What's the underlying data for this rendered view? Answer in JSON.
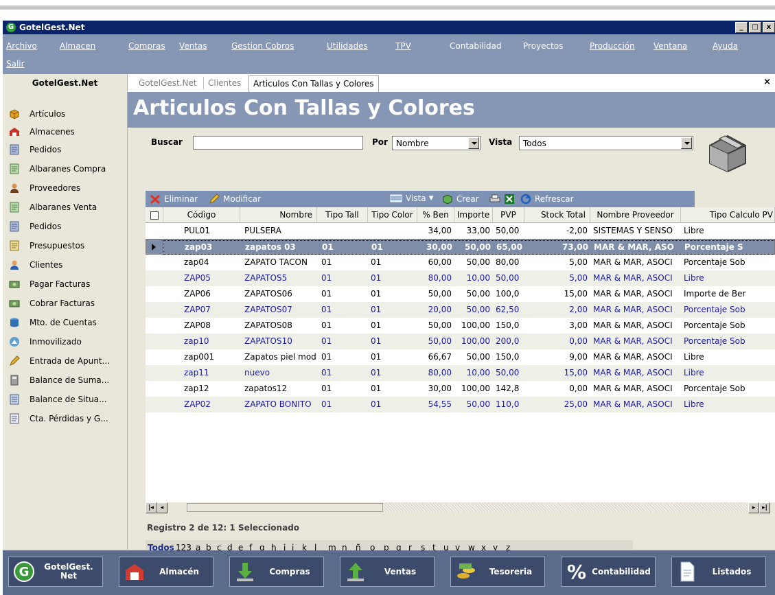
{
  "window": {
    "title": "GotelGest.Net",
    "btn_min": "_",
    "btn_max": "□",
    "btn_close": "x"
  },
  "menu": [
    "Archivo",
    "Almacen",
    "Compras",
    "Ventas",
    "Gestion Cobros",
    "Utilidades",
    "TPV",
    "Contabilidad",
    "Proyectos",
    "Producción",
    "Ventana",
    "Ayuda",
    "Salir"
  ],
  "sidebar": {
    "title": "GotelGest.Net",
    "items": [
      {
        "label": "Artículos",
        "icon": "box-icon"
      },
      {
        "label": "Almacenes",
        "icon": "warehouse-icon"
      },
      {
        "label": "Pedidos",
        "icon": "document-icon"
      },
      {
        "label": "Albaranes Compra",
        "icon": "document-icon"
      },
      {
        "label": "Proveedores",
        "icon": "person-icon"
      },
      {
        "label": "Albaranes Venta",
        "icon": "document-icon"
      },
      {
        "label": "Pedidos",
        "icon": "document-icon"
      },
      {
        "label": "Presupuestos",
        "icon": "document-icon"
      },
      {
        "label": "Clientes",
        "icon": "person-icon"
      },
      {
        "label": "Pagar Facturas",
        "icon": "money-icon"
      },
      {
        "label": "Cobrar Facturas",
        "icon": "money-icon"
      },
      {
        "label": "Mto. de Cuentas",
        "icon": "database-icon"
      },
      {
        "label": "Inmovilizado",
        "icon": "building-icon"
      },
      {
        "label": "Entrada de Apunt...",
        "icon": "pencil-icon"
      },
      {
        "label": "Balance de Suma...",
        "icon": "calculator-icon"
      },
      {
        "label": "Balance de Situa...",
        "icon": "ledger-icon"
      },
      {
        "label": "Cta. Pérdidas y G...",
        "icon": "report-icon"
      }
    ]
  },
  "tabs": {
    "crumb1": "GotelGest.Net",
    "crumb2": "Clientes",
    "active": "Articulos Con Tallas y Colores",
    "close": "×"
  },
  "page_title": "Articulos Con Tallas y Colores",
  "search": {
    "buscar_label": "Buscar",
    "buscar_value": "",
    "por_label": "Por",
    "por_value": "Nombre",
    "vista_label": "Vista",
    "vista_value": "Todos"
  },
  "toolbar": {
    "eliminar": "Eliminar",
    "modificar": "Modificar",
    "vista": "Vista",
    "crear": "Crear",
    "refrescar": "Refrescar"
  },
  "columns": [
    "Código",
    "Nombre",
    "Tipo Tall",
    "Tipo Color",
    "% Ben",
    "Importe",
    "PVP",
    "Stock Total",
    "Nombre Proveedor",
    "Tipo Calculo PV"
  ],
  "rows": [
    [
      "PUL01",
      "PULSERA",
      "",
      "",
      "34,00",
      "33,00",
      "50,00",
      "-2,00",
      "SISTEMAS Y SENSO",
      "Libre"
    ],
    [
      "zap03",
      "zapatos 03",
      "01",
      "01",
      "30,00",
      "50,00",
      "65,00",
      "73,00",
      "MAR & MAR, ASO",
      "Porcentaje S"
    ],
    [
      "zap04",
      "ZAPATO TACON",
      "01",
      "01",
      "60,00",
      "50,00",
      "80,00",
      "5,00",
      "MAR & MAR, ASOCI",
      "Porcentaje Sob"
    ],
    [
      "ZAP05",
      "ZAPATOS5",
      "01",
      "01",
      "80,00",
      "10,00",
      "50,00",
      "5,00",
      "MAR & MAR, ASOCI",
      "Libre"
    ],
    [
      "ZAP06",
      "ZAPATOS06",
      "01",
      "01",
      "50,00",
      "50,00",
      "100,0",
      "15,00",
      "MAR & MAR, ASOCI",
      "Importe de Ber"
    ],
    [
      "ZAP07",
      "ZAPATOS07",
      "01",
      "01",
      "20,00",
      "50,00",
      "62,50",
      "2,00",
      "MAR & MAR, ASOCI",
      "Porcentaje Sob"
    ],
    [
      "ZAP08",
      "ZAPATOS08",
      "01",
      "01",
      "50,00",
      "100,00",
      "150,0",
      "3,00",
      "MAR & MAR, ASOCI",
      "Porcentaje Sob"
    ],
    [
      "zap10",
      "ZAPATOS10",
      "01",
      "01",
      "50,00",
      "100,00",
      "200,0",
      "0,00",
      "MAR & MAR, ASOCI",
      "Porcentaje Sob"
    ],
    [
      "zap001",
      "Zapatos piel mod",
      "01",
      "01",
      "66,67",
      "50,00",
      "150,0",
      "9,00",
      "MAR & MAR, ASOCI",
      "Libre"
    ],
    [
      "zap11",
      "nuevo",
      "01",
      "01",
      "80,00",
      "10,00",
      "50,00",
      "15,00",
      "MAR & MAR, ASOCI",
      "Libre"
    ],
    [
      "zap12",
      "zapatos12",
      "01",
      "01",
      "30,00",
      "100,00",
      "142,8",
      "0,00",
      "MAR & MAR, ASOCI",
      "Porcentaje Sob"
    ],
    [
      "ZAP02",
      "ZAPATO BONITO",
      "01",
      "01",
      "54,55",
      "50,00",
      "110,0",
      "25,00",
      "MAR & MAR, ASOCI",
      "Libre"
    ]
  ],
  "status": "Registro 2 de 12: 1 Seleccionado",
  "alpha": [
    "Todos",
    "123",
    "a",
    "b",
    "c",
    "d",
    "e",
    "f",
    "g",
    "h",
    "i",
    "j",
    "k",
    "l",
    "m",
    "n",
    "ñ",
    "o",
    "p",
    "q",
    "r",
    "s",
    "t",
    "u",
    "v",
    "w",
    "x",
    "y",
    "z"
  ],
  "bottom": [
    "GotelGest. Net",
    "Almacén",
    "Compras",
    "Ventas",
    "Tesoreria",
    "Contabilidad",
    "Listados"
  ],
  "colors": {
    "header_band": "#8597b5",
    "title_bar": "#0a246a",
    "selected_row": "#7e8ea8",
    "link_blue": "#1a1aa0"
  }
}
